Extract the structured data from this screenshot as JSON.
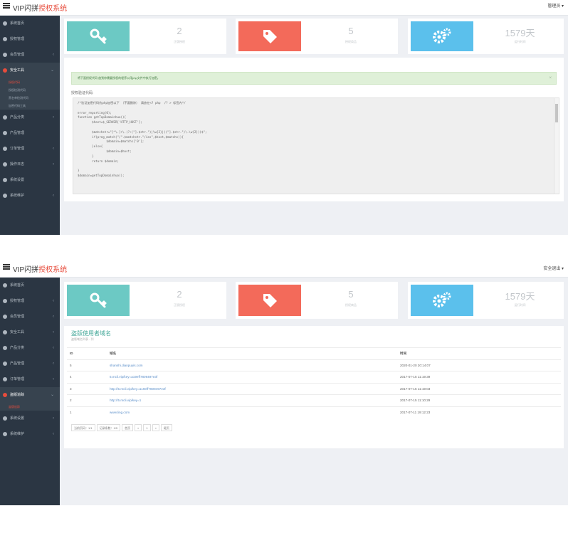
{
  "shot1": {
    "brand_main": "VIP闪拼",
    "brand_accent": "授权系统",
    "user": "管理员 ▾",
    "nav": [
      {
        "label": "系统首页",
        "arrow": ""
      },
      {
        "label": "授权管理",
        "arrow": ""
      },
      {
        "label": "会员管理",
        "arrow": "‹"
      },
      {
        "label": "安全工具",
        "arrow": "⌄",
        "active": true
      },
      {
        "label": "产品分类",
        "arrow": "‹"
      },
      {
        "label": "产品管理",
        "arrow": ""
      },
      {
        "label": "订单管理",
        "arrow": "‹"
      },
      {
        "label": "操作日志",
        "arrow": "‹"
      },
      {
        "label": "系统设置",
        "arrow": ""
      },
      {
        "label": "系统维护",
        "arrow": "‹"
      }
    ],
    "subnav": [
      {
        "label": "授权代码",
        "active": true
      },
      {
        "label": "授权检测代码"
      },
      {
        "label": "黑名单检测代码"
      },
      {
        "label": "加密代码工具"
      }
    ],
    "cards": [
      {
        "value": "2",
        "label": "正版授权",
        "color": "#6cc9c4",
        "icon": "key-icon"
      },
      {
        "value": "5",
        "label": "授权商品",
        "color": "#f36a5a",
        "icon": "tag-icon"
      },
      {
        "value": "1579天",
        "label": "运行时间",
        "color": "#5bc0ec",
        "icon": "gears-icon"
      }
    ],
    "alert": "将下面授权代码 放到你需要授权的程序公用php文件中执行加密。",
    "alert_close": "×",
    "code_label": "授权验证代码:",
    "code_lines": [
      "/*验证加密代码仿php加密以下 （不要删除） 请放在<? php  /? > 标签内*/",
      "",
      "error_reporting(0);",
      "function getTopDomainhuo(){",
      "        $host=$_SERVER['HTTP_HOST'];",
      "",
      "        $matchstr=\"[^\\.]+\\.(?:(\"].$str.\")|\\w{2}|((\"].$str.\")\\.\\w{2}))$\";",
      "        if(preg_match(\"/\".$matchstr.\"/ies\",$host,$matchs)){",
      "                $domain=$matchs['0'];",
      "        }else{",
      "                $domain=$host;",
      "        }",
      "        return $domain;",
      "",
      "}",
      "$domain=getTopDomainhuo();"
    ]
  },
  "shot2": {
    "brand_main": "VIP闪拼",
    "brand_accent": "授权系统",
    "user": "安全退出 ▾",
    "nav": [
      {
        "label": "系统首页",
        "arrow": ""
      },
      {
        "label": "授权管理",
        "arrow": "‹"
      },
      {
        "label": "会员管理",
        "arrow": "‹"
      },
      {
        "label": "安全工具",
        "arrow": "‹"
      },
      {
        "label": "产品分类",
        "arrow": "‹"
      },
      {
        "label": "产品管理",
        "arrow": "‹"
      },
      {
        "label": "订单管理",
        "arrow": "‹"
      },
      {
        "label": "盗版追踪",
        "arrow": "⌄",
        "active": true
      },
      {
        "label": "系统设置",
        "arrow": "‹"
      },
      {
        "label": "系统维护",
        "arrow": "‹"
      }
    ],
    "subnav": [
      {
        "label": "盗版追踪",
        "active": true
      }
    ],
    "cards": [
      {
        "value": "2",
        "label": "正版授权",
        "color": "#6cc9c4",
        "icon": "key-icon"
      },
      {
        "value": "5",
        "label": "授权商品",
        "color": "#f36a5a",
        "icon": "tag-icon"
      },
      {
        "value": "1579天",
        "label": "运行时间",
        "color": "#5bc0ec",
        "icon": "gears-icon"
      }
    ],
    "table_title": "盗版使用者域名",
    "table_sub": "盗版域名列表 - 列",
    "headers": [
      "ID",
      "域名",
      "时间"
    ],
    "rows": [
      {
        "id": "5",
        "domain": "shanshi.dianpuyis.com",
        "time": "2020-01-20 20:14:07"
      },
      {
        "id": "4",
        "domain": "5.mcli.vip/key=a19eff7809497e3f",
        "time": "2017-07-15 11:19:39"
      },
      {
        "id": "3",
        "domain": "http://5.mcli.vip/key=a19eff7809497e3f",
        "time": "2017-07-15 11:19:03"
      },
      {
        "id": "2",
        "domain": "http://5.mcli.vip/key=1",
        "time": "2017-07-15 11:10:29"
      },
      {
        "id": "1",
        "domain": "www.ling.com",
        "time": "2017-07-11 19:12:23"
      }
    ],
    "pager": [
      "当前页码：1/1",
      "记录条数：1/5",
      "首页",
      "«",
      "1",
      "»",
      "尾页"
    ]
  }
}
